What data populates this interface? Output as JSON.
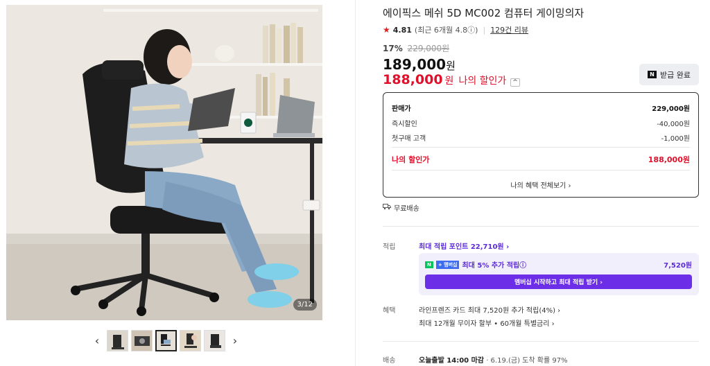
{
  "gallery": {
    "counter": "3/12",
    "prev_icon": "chevron-left-icon",
    "next_icon": "chevron-right-icon",
    "thumb_count": 5,
    "active_thumb_index": 2
  },
  "product": {
    "title": "에이픽스 메쉬 5D MC002 컴퓨터 게이밍의자",
    "rating": "4.81",
    "rating_sub": "(최근 6개월 4.8ⓘ)",
    "reviews": "129건 리뷰",
    "discount_pct": "17%",
    "original_price": "229,000원",
    "price": "189,000",
    "price_unit": "원",
    "my_price": "188,000",
    "my_price_unit": "원",
    "my_price_label": "나의 할인가",
    "my_price_toggle": "^",
    "coupon_label": "받급 완료",
    "coupon_logo": "N"
  },
  "price_box": {
    "rows": [
      {
        "label": "판매가",
        "value": "229,000원"
      },
      {
        "label": "즉시할인",
        "value": "-40,000원"
      },
      {
        "label": "첫구매 고객",
        "value": "-1,000원"
      }
    ],
    "final_label": "나의 할인가",
    "final_value": "188,000원",
    "more_label": "나의 혜택 전체보기 ›"
  },
  "shipping": {
    "free_label": "무료배송"
  },
  "points": {
    "label": "적립",
    "max_points": "최대 적립 포인트 22,710원 ›",
    "member_badge_n": "N",
    "member_badge_plus": "+ 멤버십",
    "member_text": "최대 5% 추가 적립ⓘ",
    "member_value": "7,520원",
    "member_cta": "멤버십 시작하고 최대 적립 받기 ›"
  },
  "benefits": {
    "label": "혜택",
    "line1": "라인프렌즈 카드 최대 7,520원 추가 적립(4%) ›",
    "line2": "최대 12개월 무이자 할부 • 60개월 특별금리 ›"
  },
  "delivery": {
    "label": "배송",
    "deadline": "오늘출발 14:00 마감",
    "detail": "· 6.19.(금) 도착 확률 97%"
  },
  "colors": {
    "accent_red": "#e0102b",
    "accent_purple": "#6c2ee6",
    "naver_green": "#03c75a"
  }
}
